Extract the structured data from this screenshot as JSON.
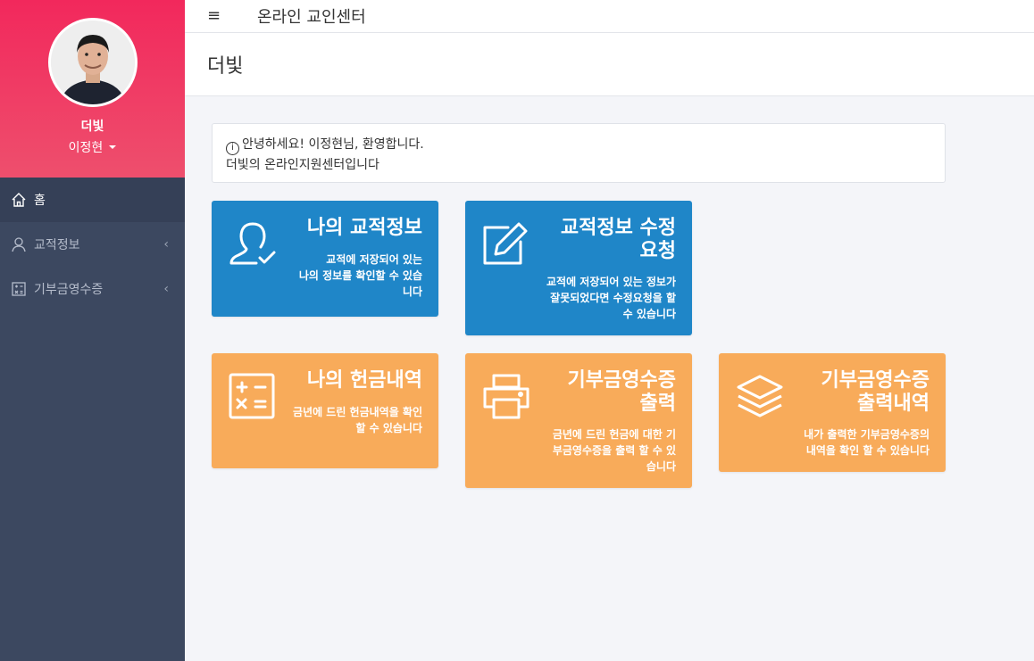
{
  "app": {
    "title": "온라인 교인센터"
  },
  "profile": {
    "org_name": "더빛",
    "user_name": "이정현"
  },
  "sidebar": {
    "items": [
      {
        "label": "홈"
      },
      {
        "label": "교적정보"
      },
      {
        "label": "기부금영수증"
      }
    ]
  },
  "page": {
    "title": "더빛"
  },
  "notice": {
    "line1": "안녕하세요! 이정현님, 환영합니다.",
    "line2": "더빛의 온라인지원센터입니다"
  },
  "cards": [
    {
      "title_line1": "나의 교적정보",
      "title_line2": "",
      "desc_line1": "교적에 저장되어 있는",
      "desc_line2": "나의 정보를 확인할 수 있습",
      "desc_line3": "니다",
      "color": "#1f86c8",
      "icon": "user-check-icon"
    },
    {
      "title_line1": "교적정보 수정",
      "title_line2": "요청",
      "desc_line1": "교적에 저장되어 있는 정보가",
      "desc_line2": "잘못되었다면 수정요청을 할",
      "desc_line3": "수 있습니다",
      "color": "#1f86c8",
      "icon": "edit-icon"
    },
    {
      "title_line1": "나의 헌금내역",
      "title_line2": "",
      "desc_line1": "금년에 드린 헌금내역을 확인",
      "desc_line2": "할 수 있습니다",
      "desc_line3": "",
      "color": "#f8ab5a",
      "icon": "calculator-icon"
    },
    {
      "title_line1": "기부금영수증",
      "title_line2": "출력",
      "desc_line1": "금년에 드린 헌금에 대한 기",
      "desc_line2": "부금영수증을 출력 할 수 있",
      "desc_line3": "습니다",
      "color": "#f8ab5a",
      "icon": "printer-icon"
    },
    {
      "title_line1": "기부금영수증",
      "title_line2": "출력내역",
      "desc_line1": "내가 출력한 기부금영수증의",
      "desc_line2": "내역을 확인 할 수 있습니다",
      "desc_line3": "",
      "color": "#f8ab5a",
      "icon": "layers-icon"
    }
  ]
}
